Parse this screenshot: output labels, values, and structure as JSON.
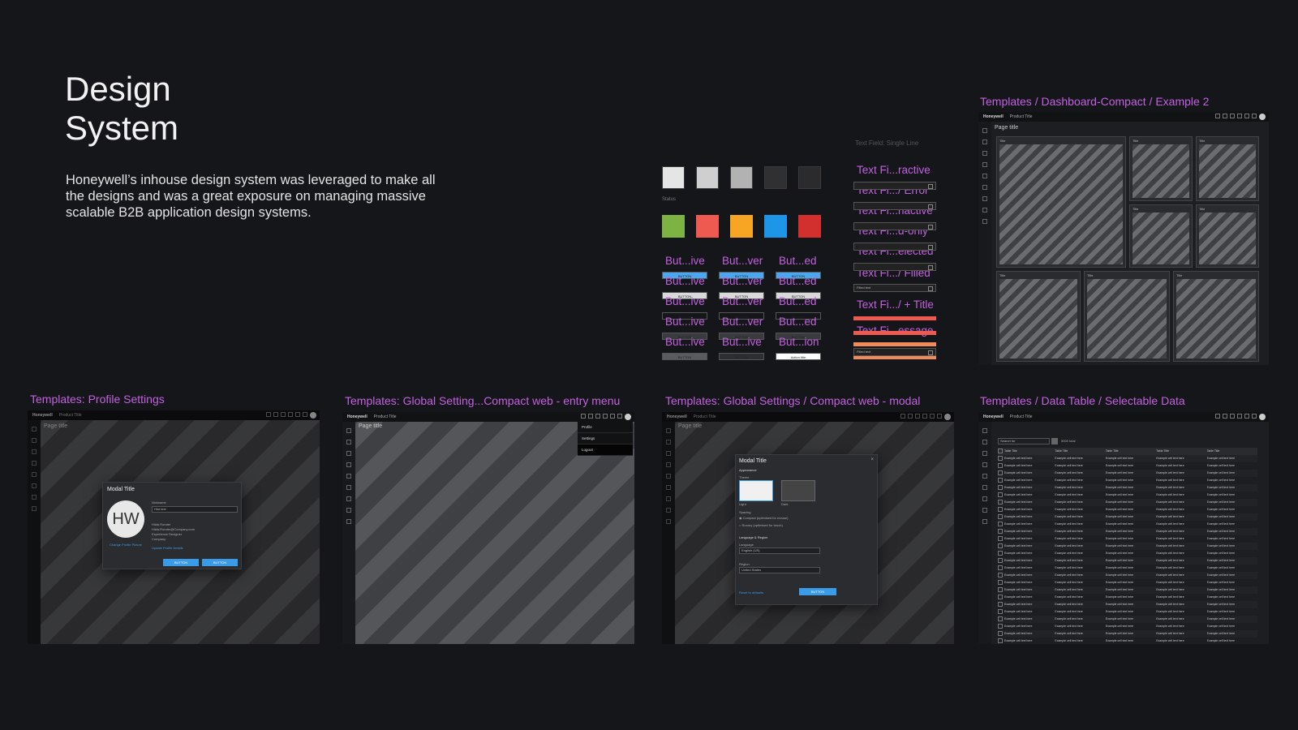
{
  "hero": {
    "title_line1": "Design",
    "title_line2": "System",
    "description": "Honeywell’s inhouse design system was leveraged to make all the designs and was a great exposure on managing massive scalable B2B application design systems."
  },
  "swatches": {
    "neutrals": [
      "#e5e5e5",
      "#cfcfcf",
      "#b2b2b2",
      "#303032",
      "#2b2b2d"
    ],
    "status_label": "Status",
    "status": [
      "#7cb342",
      "#ef5a50",
      "#f6a623",
      "#1e96e8",
      "#d32f2f"
    ]
  },
  "buttons": {
    "columns": [
      [
        "But...ive",
        "But...ive",
        "But...ive",
        "But...ive",
        "But...ive"
      ],
      [
        "But...ver",
        "But...ver",
        "But...ver",
        "But...ver",
        "But...ive"
      ],
      [
        "But...ed",
        "But...ed",
        "But...ed",
        "But...ed",
        "But...ion"
      ]
    ],
    "bar_text": "BUTTON",
    "bar_text_alt": "Action title"
  },
  "textfields": {
    "heading": "Text Field: Single Line",
    "labels": [
      "Text Fi...ractive",
      "Text Fi.../ Error",
      "Text Fi...nactive",
      "Text Fi...d-only",
      "Text Fi...elected",
      "Text Fi.../ Filled",
      "Text Fi.../ + Title",
      "Text Fi...essage"
    ],
    "filled_text": "Filled text"
  },
  "templates": {
    "dashboard": "Templates / Dashboard-Compact / Example 2",
    "profile": "Templates: Profile Settings",
    "entry_menu": "Templates: Global Setting...Compact web - entry menu",
    "modal": "Templates: Global Settings / Compact web -  modal",
    "data_table": "Templates / Data Table / Selectable Data"
  },
  "app": {
    "logo": "Honeywell",
    "product_title": "Product Title",
    "page_title": "Page title",
    "tile_title": "Title"
  },
  "profile_modal": {
    "title": "Modal Title",
    "initials": "HW",
    "nickname_label": "Nickname",
    "nickname_value": "Hint text",
    "name": "Hilda Ronder",
    "email": "Hilda.Ronder@Company.com",
    "role": "Experience Designer",
    "company": "Company",
    "change_link": "Change Profile Picture",
    "update_link": "Update Profile Details",
    "button1": "BUTTON",
    "button2": "BUTTON"
  },
  "entry_menu": {
    "items": [
      "Profile",
      "Settings",
      "Logout"
    ]
  },
  "settings_modal": {
    "title": "Modal Title",
    "appearance": "Appearance",
    "theme": "Theme",
    "light": "Light",
    "dark": "Dark",
    "spacing": "Spacing",
    "opt1": "Compact (optimised for mouse)",
    "opt2": "Roomy (optimised for touch)",
    "lang_region": "Language & Region",
    "language_label": "Language",
    "language_value": "English (US)",
    "region_label": "Region",
    "region_value": "United States",
    "reset": "Reset to defaults",
    "button": "BUTTON"
  },
  "data_table": {
    "search_placeholder": "Search for",
    "total": "5000 total",
    "header": "Table Title",
    "cell": "Example cell text here"
  }
}
